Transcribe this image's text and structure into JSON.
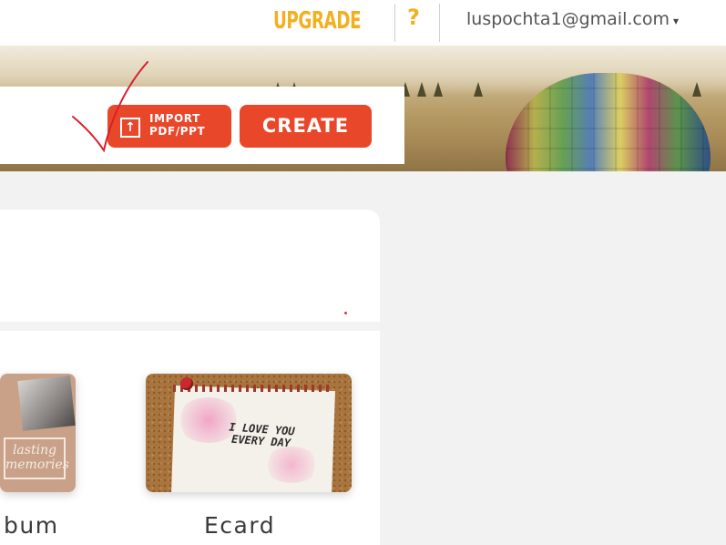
{
  "header": {
    "upgrade_label": "UPGRADE",
    "help_label": "?",
    "account_email": "luspochta1@gmail.com",
    "account_caret": "▾"
  },
  "banner": {
    "import_icon": "upload-icon",
    "import_label": "IMPORT\nPDF/PPT",
    "create_label": "CREATE"
  },
  "templates": {
    "items": [
      {
        "label": "bum",
        "thumb_text": "lasting\nmemories"
      },
      {
        "label": "Ecard",
        "thumb_text": "I LOVE YOU\nEVERY DAY"
      }
    ]
  },
  "colors": {
    "accent": "#e8472a",
    "upgrade": "#f2b01e",
    "page_bg": "#f2f2f2"
  }
}
